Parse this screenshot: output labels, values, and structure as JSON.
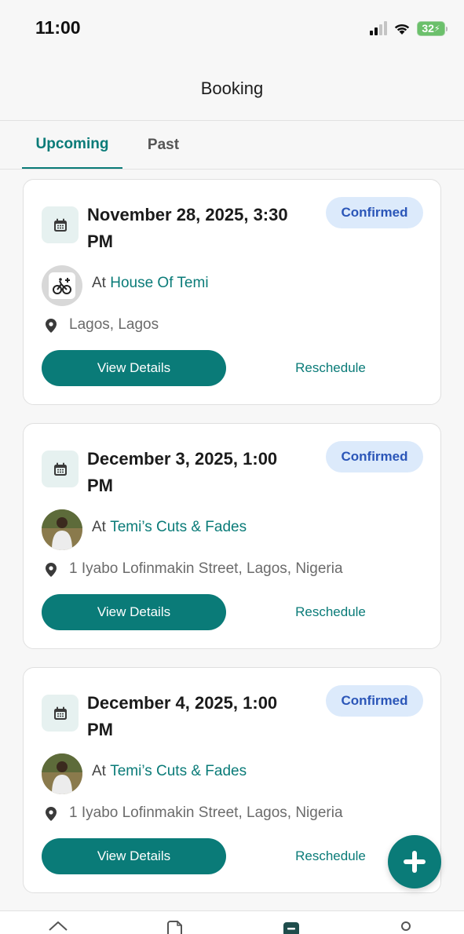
{
  "status_bar": {
    "time": "11:00",
    "battery": "32",
    "icons": [
      "signal-icon",
      "wifi-icon",
      "battery-charging-icon"
    ]
  },
  "header": {
    "title": "Booking"
  },
  "tabs": [
    {
      "label": "Upcoming",
      "active": true
    },
    {
      "label": "Past",
      "active": false
    }
  ],
  "bookings": [
    {
      "date_line1": "November 28, 2025, 3:30",
      "date_line2": "PM",
      "status": "Confirmed",
      "at_prefix": "At",
      "venue": "House Of Temi",
      "address": "Lagos, Lagos",
      "avatar": "business-logo",
      "view_label": "View Details",
      "reschedule_label": "Reschedule"
    },
    {
      "date_line1": "December 3, 2025, 1:00",
      "date_line2": "PM",
      "status": "Confirmed",
      "at_prefix": "At",
      "venue": "Temi’s Cuts & Fades",
      "address": "1 Iyabo Lofinmakin Street, Lagos, Nigeria",
      "avatar": "person-photo",
      "view_label": "View Details",
      "reschedule_label": "Reschedule"
    },
    {
      "date_line1": "December 4, 2025, 1:00",
      "date_line2": "PM",
      "status": "Confirmed",
      "at_prefix": "At",
      "venue": "Temi’s Cuts & Fades",
      "address": "1 Iyabo Lofinmakin Street, Lagos, Nigeria",
      "avatar": "person-photo",
      "view_label": "View Details",
      "reschedule_label": "Reschedule"
    }
  ],
  "fab": {
    "icon": "plus-icon"
  },
  "bottom_nav": {
    "icons": [
      "home-icon",
      "document-icon",
      "booking-icon",
      "profile-icon"
    ],
    "active": "booking-icon"
  },
  "colors": {
    "accent": "#0a7b78",
    "badge_bg": "#dceafb",
    "badge_text": "#2b56b8",
    "background": "#f7f7f7"
  }
}
